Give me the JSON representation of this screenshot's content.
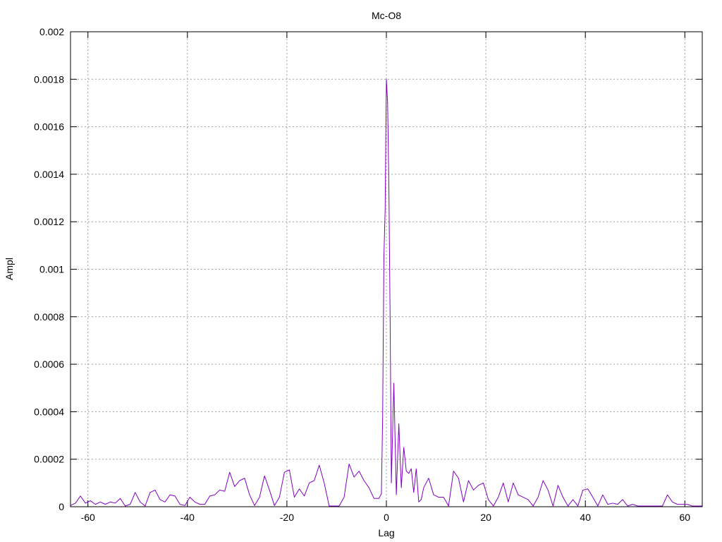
{
  "chart_data": {
    "type": "line",
    "title": "Mc-O8",
    "xlabel": "Lag",
    "ylabel": "Ampl",
    "xlim": [
      -63.5,
      63.5
    ],
    "ylim": [
      0,
      0.002
    ],
    "grid": true,
    "xticks": [
      -60,
      -40,
      -20,
      0,
      20,
      40,
      60
    ],
    "xtick_labels": [
      "-60",
      "-40",
      "-20",
      "0",
      "20",
      "40",
      "60"
    ],
    "yticks": [
      0,
      0.0002,
      0.0004,
      0.0006,
      0.0008,
      0.001,
      0.0012,
      0.0014,
      0.0016,
      0.0018,
      0.002
    ],
    "ytick_labels": [
      "0",
      "0.0002",
      "0.0004",
      "0.0006",
      "0.0008",
      "0.001",
      "0.0012",
      "0.0014",
      "0.0016",
      "0.0018",
      "0.002"
    ],
    "series": [
      {
        "color": "#8000c0",
        "x": [
          -63.5,
          -62.5,
          -61.5,
          -60.5,
          -59.5,
          -58.5,
          -57.5,
          -56.5,
          -55.5,
          -54.5,
          -53.5,
          -52.5,
          -51.5,
          -50.5,
          -49.5,
          -48.5,
          -47.5,
          -46.5,
          -45.5,
          -44.5,
          -43.5,
          -42.5,
          -41.5,
          -40.5,
          -39.5,
          -38.5,
          -37.5,
          -36.5,
          -35.5,
          -34.5,
          -33.5,
          -32.5,
          -31.5,
          -30.5,
          -29.5,
          -28.5,
          -27.5,
          -26.5,
          -25.5,
          -24.5,
          -23.5,
          -22.5,
          -21.5,
          -20.5,
          -19.5,
          -18.5,
          -17.5,
          -16.5,
          -15.5,
          -14.5,
          -13.5,
          -12.5,
          -11.5,
          -10.5,
          -9.5,
          -8.5,
          -7.5,
          -6.5,
          -5.5,
          -4.5,
          -3.5,
          -2.5,
          -1.5,
          -1.0,
          -0.75,
          -0.5,
          -0.25,
          0,
          0.25,
          0.5,
          0.75,
          1.0,
          1.5,
          2.0,
          2.5,
          3.0,
          3.5,
          4.0,
          4.5,
          5.0,
          5.5,
          6.0,
          6.5,
          7.0,
          7.5,
          8.5,
          9.5,
          10.5,
          11.5,
          12.5,
          13.5,
          14.5,
          15.5,
          16.5,
          17.5,
          18.5,
          19.5,
          20.5,
          21.5,
          22.5,
          23.5,
          24.5,
          25.5,
          26.5,
          27.5,
          28.5,
          29.5,
          30.5,
          31.5,
          32.5,
          33.5,
          34.5,
          35.5,
          36.5,
          37.5,
          38.5,
          39.5,
          40.5,
          41.5,
          42.5,
          43.5,
          44.5,
          45.5,
          46.5,
          47.5,
          48.5,
          49.5,
          50.5,
          51.5,
          52.5,
          53.5,
          54.5,
          55.5,
          56.5,
          57.5,
          58.5,
          59.5,
          60.5,
          61.5,
          62.5,
          63.5
        ],
        "y": [
          5e-06,
          1.5e-05,
          4.5e-05,
          1.5e-05,
          2.5e-05,
          1e-05,
          2e-05,
          1e-05,
          2e-05,
          1.5e-05,
          3.5e-05,
          3e-06,
          1e-05,
          6e-05,
          2e-05,
          3e-06,
          6e-05,
          7e-05,
          3e-05,
          2e-05,
          5e-05,
          4.5e-05,
          1e-05,
          5e-06,
          4e-05,
          2e-05,
          1e-05,
          1e-05,
          4.5e-05,
          5e-05,
          7e-05,
          6.5e-05,
          0.000145,
          8.5e-05,
          0.00011,
          0.00012,
          5e-05,
          5e-06,
          4e-05,
          0.00013,
          7e-05,
          5e-06,
          4e-05,
          0.000145,
          0.000155,
          4e-05,
          7.5e-05,
          4.5e-05,
          0.0001,
          0.00011,
          0.000175,
          0.0001,
          3e-06,
          3e-06,
          3e-06,
          4e-05,
          0.00018,
          0.000125,
          0.00015,
          0.00011,
          8e-05,
          3.5e-05,
          3.5e-05,
          5.5e-05,
          0.00038,
          0.00105,
          0.00125,
          0.0018,
          0.0017,
          0.00135,
          0.0008,
          0.0001,
          0.00052,
          5e-05,
          0.00035,
          8e-05,
          0.00025,
          0.00015,
          0.00014,
          0.00016,
          6e-05,
          0.00016,
          2e-05,
          3e-05,
          8e-05,
          0.00012,
          5e-05,
          4e-05,
          4e-05,
          3e-06,
          0.00015,
          0.00012,
          2e-05,
          0.00011,
          7e-05,
          9e-05,
          0.0001,
          3e-05,
          3e-06,
          4e-05,
          0.0001,
          2e-05,
          0.0001,
          5e-05,
          4e-05,
          3e-05,
          3e-06,
          4e-05,
          0.00011,
          7e-05,
          3e-06,
          9e-05,
          4e-05,
          3e-06,
          3e-05,
          3e-06,
          7e-05,
          7.5e-05,
          4e-05,
          3e-06,
          5e-05,
          1e-05,
          1.5e-05,
          1e-05,
          3e-05,
          3e-06,
          1e-05,
          3e-06,
          3e-06,
          3e-06,
          3e-06,
          3e-06,
          3e-06,
          5e-05,
          2e-05,
          1e-05,
          1e-05,
          1e-05,
          3e-06,
          3e-06,
          3e-06
        ]
      }
    ]
  }
}
